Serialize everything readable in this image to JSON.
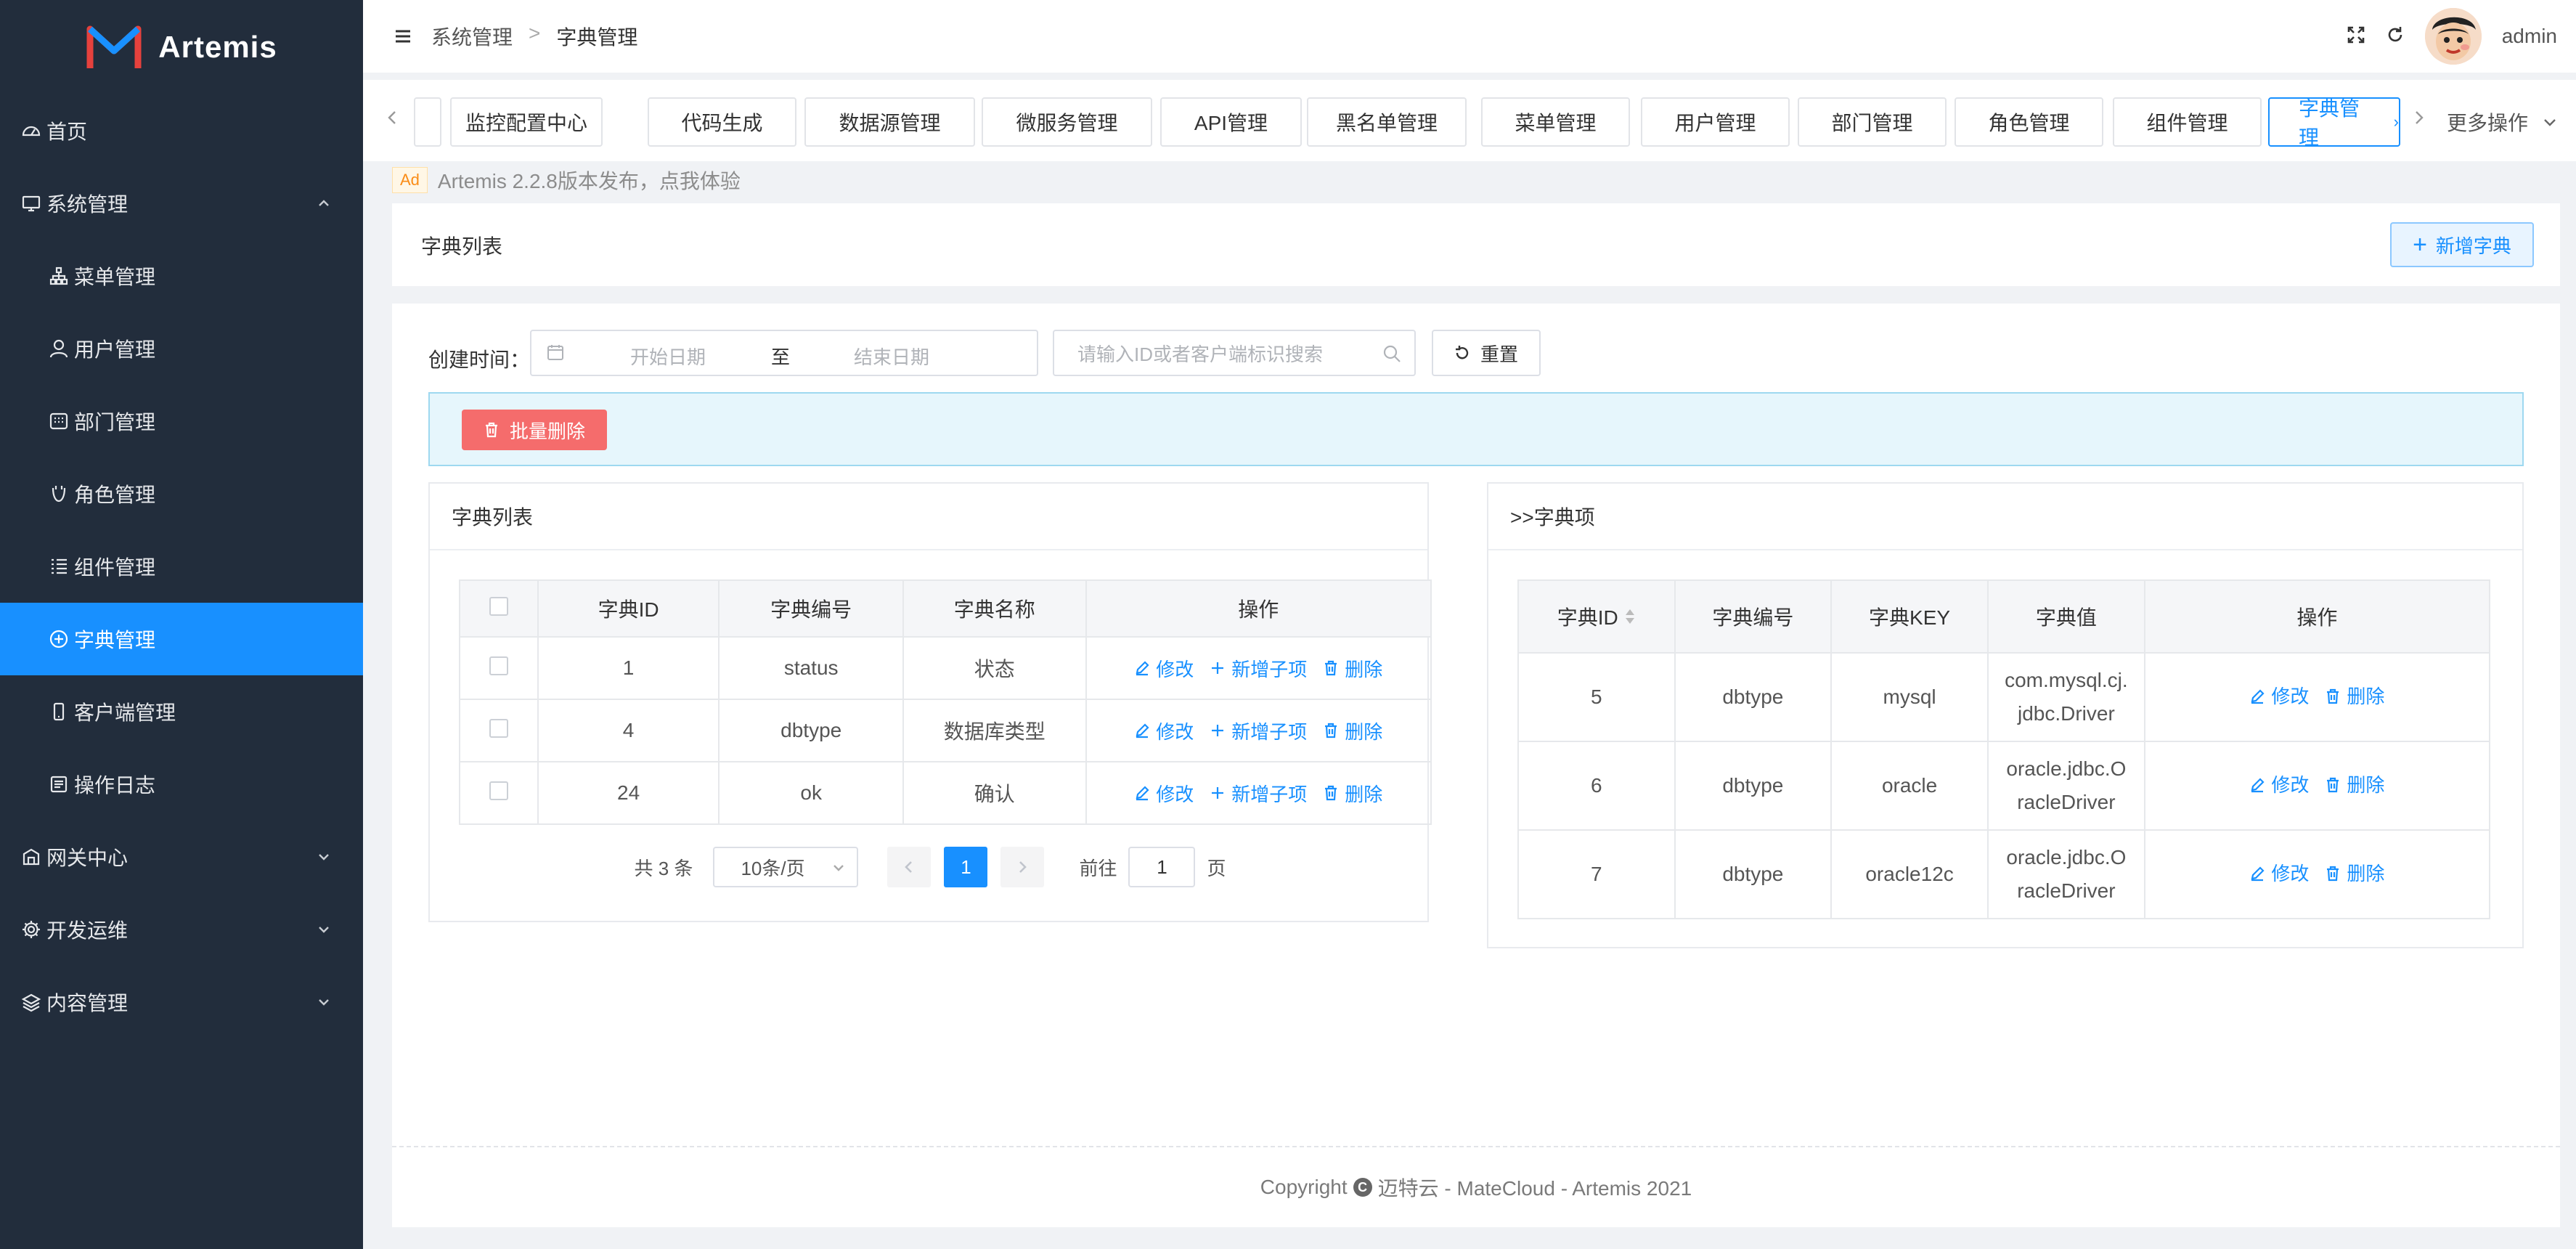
{
  "app": {
    "name": "Artemis"
  },
  "sidebar": {
    "items": [
      {
        "label": "首页",
        "icon": "dashboard-icon",
        "level": "top",
        "expandable": false
      },
      {
        "label": "系统管理",
        "icon": "monitor-icon",
        "level": "top",
        "expandable": true,
        "expanded": true
      },
      {
        "label": "菜单管理",
        "icon": "sitemap-icon",
        "level": "sub"
      },
      {
        "label": "用户管理",
        "icon": "user-icon",
        "level": "sub"
      },
      {
        "label": "部门管理",
        "icon": "department-icon",
        "level": "sub"
      },
      {
        "label": "角色管理",
        "icon": "role-icon",
        "level": "sub"
      },
      {
        "label": "组件管理",
        "icon": "list-icon",
        "level": "sub"
      },
      {
        "label": "字典管理",
        "icon": "plus-circle-icon",
        "level": "sub",
        "active": true
      },
      {
        "label": "客户端管理",
        "icon": "mobile-icon",
        "level": "sub"
      },
      {
        "label": "操作日志",
        "icon": "log-icon",
        "level": "sub"
      },
      {
        "label": "网关中心",
        "icon": "gateway-icon",
        "level": "top",
        "expandable": true
      },
      {
        "label": "开发运维",
        "icon": "gear-icon",
        "level": "top",
        "expandable": true
      },
      {
        "label": "内容管理",
        "icon": "layers-icon",
        "level": "top",
        "expandable": true
      }
    ]
  },
  "header": {
    "breadcrumb": [
      "系统管理",
      "字典管理"
    ],
    "breadcrumb_sep": ">",
    "username": "admin"
  },
  "tabs": {
    "items": [
      "",
      "监控配置中心",
      "代码生成",
      "数据源管理",
      "微服务管理",
      "API管理",
      "黑名单管理",
      "菜单管理",
      "用户管理",
      "部门管理",
      "角色管理",
      "组件管理",
      "字典管理"
    ],
    "active_index": 12,
    "more_label": "更多操作"
  },
  "ad": {
    "tag": "Ad",
    "text": "Artemis 2.2.8版本发布，点我体验"
  },
  "page": {
    "title": "字典列表",
    "add_button": "新增字典"
  },
  "filter": {
    "label": "创建时间：",
    "start_placeholder": "开始日期",
    "to_label": "至",
    "end_placeholder": "结束日期",
    "search_placeholder": "请输入ID或者客户端标识搜索",
    "reset_label": "重置",
    "batch_delete_label": "批量删除"
  },
  "left_panel": {
    "title": "字典列表",
    "columns": [
      "字典ID",
      "字典编号",
      "字典名称",
      "操作"
    ],
    "rows": [
      {
        "id": "1",
        "code": "status",
        "name": "状态"
      },
      {
        "id": "4",
        "code": "dbtype",
        "name": "数据库类型"
      },
      {
        "id": "24",
        "code": "ok",
        "name": "确认"
      }
    ],
    "ops": {
      "edit": "修改",
      "add_child": "新增子项",
      "delete": "删除"
    },
    "pagination": {
      "total": "共 3 条",
      "page_size": "10条/页",
      "current": "1",
      "goto_label": "前往",
      "goto_value": "1",
      "page_suffix": "页"
    }
  },
  "right_panel": {
    "title": ">>字典项",
    "columns": [
      "字典ID",
      "字典编号",
      "字典KEY",
      "字典值",
      "操作"
    ],
    "rows": [
      {
        "id": "5",
        "code": "dbtype",
        "key": "mysql",
        "value_line1": "com.mysql.cj.",
        "value_line2": "jdbc.Driver"
      },
      {
        "id": "6",
        "code": "dbtype",
        "key": "oracle",
        "value_line1": "oracle.jdbc.O",
        "value_line2": "racleDriver"
      },
      {
        "id": "7",
        "code": "dbtype",
        "key": "oracle12c",
        "value_line1": "oracle.jdbc.O",
        "value_line2": "racleDriver"
      }
    ],
    "ops": {
      "edit": "修改",
      "delete": "删除"
    }
  },
  "footer": {
    "prefix": "Copyright",
    "text": "迈特云 - MateCloud - Artemis 2021"
  },
  "colors": {
    "primary": "#1890ff",
    "sidebar_bg": "#222d3c",
    "danger": "#f56c6c"
  }
}
